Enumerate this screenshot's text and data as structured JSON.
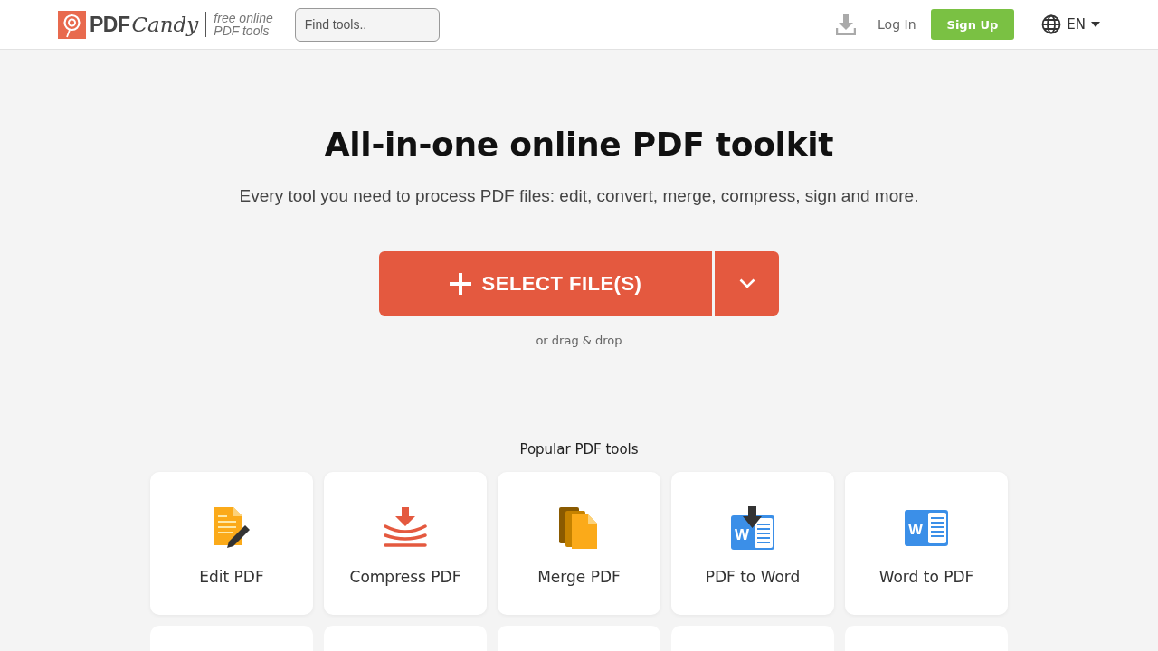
{
  "header": {
    "logo": {
      "bold": "PDF",
      "script": "Candy"
    },
    "tagline": [
      "free online",
      "PDF tools"
    ],
    "search": {
      "placeholder": "Find tools.."
    },
    "login": "Log In",
    "signup": "Sign Up",
    "language": "EN"
  },
  "hero": {
    "title": "All-in-one online PDF toolkit",
    "subtitle": "Every tool you need to process PDF files: edit, convert, merge, compress, sign and more.",
    "select_button": "SELECT FILE(S)",
    "hint": "or drag & drop"
  },
  "popular": {
    "heading": "Popular PDF tools",
    "tools": [
      {
        "label": "Edit PDF",
        "kind": "edit"
      },
      {
        "label": "Compress PDF",
        "kind": "compress"
      },
      {
        "label": "Merge PDF",
        "kind": "merge"
      },
      {
        "label": "PDF to Word",
        "kind": "pdf2word",
        "icon_letter": "W"
      },
      {
        "label": "Word to PDF",
        "kind": "word2pdf",
        "icon_letter": "W"
      }
    ]
  }
}
